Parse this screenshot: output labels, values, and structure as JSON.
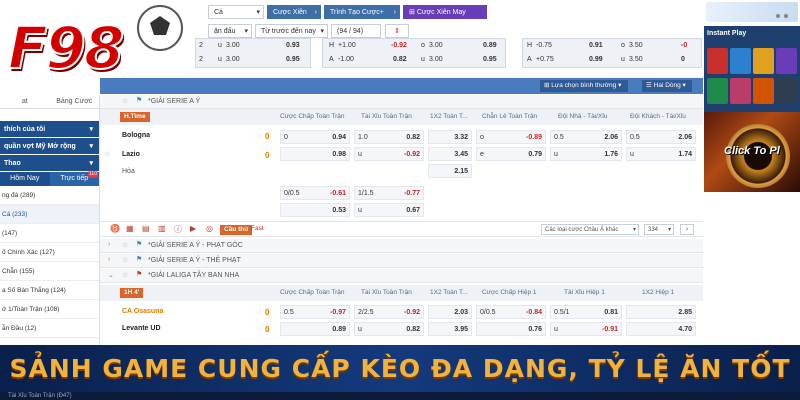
{
  "logo": {
    "text": "F98"
  },
  "topbar": {
    "filter1": "Cá",
    "cuoc_xien": "Cược Xiên",
    "trinh_tao": "Trình Tạo Cược+",
    "cuoc_xien_may_man": "Cược Xiên May Mắn",
    "filter2": "ận đấu",
    "filter3": "Từ trước đến nay",
    "count": "(94 / 94) Giải",
    "filter4": "Lựa chọn bình thường",
    "filter5": "Hai Dòng"
  },
  "top_odds": {
    "b1": [
      {
        "l": "u",
        "a": "3.00",
        "b": "0.93"
      },
      {
        "l": "u",
        "a": "3.00",
        "b": "0.95"
      }
    ],
    "b2": [
      {
        "l": "H",
        "a": "+1.00",
        "b": "-0.92",
        "l2": "o",
        "a2": "3.00",
        "b2": "0.89"
      },
      {
        "l": "A",
        "a": "-1.00",
        "b": "0.82",
        "l2": "u",
        "a2": "3.00",
        "b2": "0.95"
      }
    ],
    "b3": [
      {
        "l": "H",
        "a": "-0.75",
        "b": "0.91",
        "l2": "o",
        "a2": "3.50",
        "b2": "-0"
      },
      {
        "l": "A",
        "a": "+0.75",
        "b": "0.99",
        "l2": "u",
        "a2": "3.50",
        "b2": "0"
      }
    ],
    "prefix1": "2",
    "prefix2": "2"
  },
  "sidebar": {
    "tab1": "at",
    "tab2": "Bảng Cược",
    "head1": "thích của tôi",
    "head2": "quần vợt Mỹ Mở rộng",
    "head3": "Thao",
    "subtab1": "Hôm Nay",
    "subtab2": "Trực tiếp",
    "live_count": "110",
    "items": [
      "ng đá (289)",
      "Cá (233)",
      "(147)",
      "ố Chính Xác (127)",
      "Chẵn (155)",
      "a Số Bàn Thắng (124)",
      "ớ 1/Toàn Trận (108)",
      "ẫn Đầu (12)"
    ]
  },
  "main": {
    "league1": "*GIẢI SERIE A Ý",
    "status1": "H.Time",
    "headers1": [
      "Cược Chấp Toàn Trận",
      "Tài Xỉu Toàn Trận",
      "1X2 Toàn T...",
      "Chẵn Lẻ Toàn Trận",
      "Đội Nhà - Tài/Xỉu",
      "Đội Khách - Tài/Xỉu"
    ],
    "team1": "Bologna",
    "team2": "Lazio",
    "draw": "Hòa",
    "score1": "0",
    "score2": "0",
    "m1": {
      "hc1": "0",
      "hc1v": "0.94",
      "hc2v": "0.98",
      "ou1": "1.0",
      "ou1v": "0.82",
      "ou2": "u",
      "ou2v": "-0.92",
      "x1": "3.32",
      "x2": "3.45",
      "xd": "2.15",
      "oe1": "o",
      "oe1v": "-0.89",
      "oe2": "e",
      "oe2v": "0.79",
      "h1": "0.5",
      "h1v": "2.06",
      "h2": "u",
      "h2v": "1.76",
      "a1": "0.5",
      "a1v": "2.06",
      "a2": "u",
      "a2v": "1.74",
      "hc3": "0/0.5",
      "hc3v": "-0.61",
      "hc4v": "0.53",
      "ou3": "1/1.5",
      "ou3v": "-0.77",
      "ou4": "u",
      "ou4v": "0.67"
    },
    "toolbar": {
      "cau_thu": "Cầu thủ",
      "fast": "Fast",
      "sort": "Các loại cược Châu Á khác",
      "count": "334"
    },
    "sub1": "*GIẢI SERIE A Ý - PHẠT GÓC",
    "sub2": "*GIẢI SERIE A Ý - THẺ PHẠT",
    "league2": "*GIẢI LALIGA TÂY BAN NHA",
    "status2": "1H  4'",
    "headers2": [
      "Cược Chấp Toàn Trận",
      "Tài Xỉu Toàn Trận",
      "1X2 Toàn T...",
      "Cược Chấp Hiệp 1",
      "Tài Xỉu Hiệp 1",
      "1X2 Hiệp 1"
    ],
    "team3": "CA Osasuna",
    "team4": "Levante UD",
    "score3": "0",
    "score4": "0",
    "m2": {
      "hc1": "0.5",
      "hc1v": "-0.97",
      "hc2v": "0.89",
      "ou1": "2/2.5",
      "ou1v": "-0.92",
      "ou2": "u",
      "ou2v": "0.82",
      "x1": "2.03",
      "x2": "3.95",
      "h1": "0/0.5",
      "h1v": "-0.84",
      "h2v": "0.76",
      "t1": "0.5/1",
      "t1v": "0.81",
      "t2": "u",
      "t2v": "-0.91",
      "y1": "2.85",
      "y2": "4.70"
    }
  },
  "right": {
    "instant_play": "Instant Play",
    "click_to_play": "Click To Pl"
  },
  "banner": {
    "text": "SẢNH GAME CUNG CẤP KÈO ĐA DẠNG, TỶ LỆ ĂN TỐT",
    "bottom": "Tài Xỉu Toàn Trận (Đ47)"
  }
}
